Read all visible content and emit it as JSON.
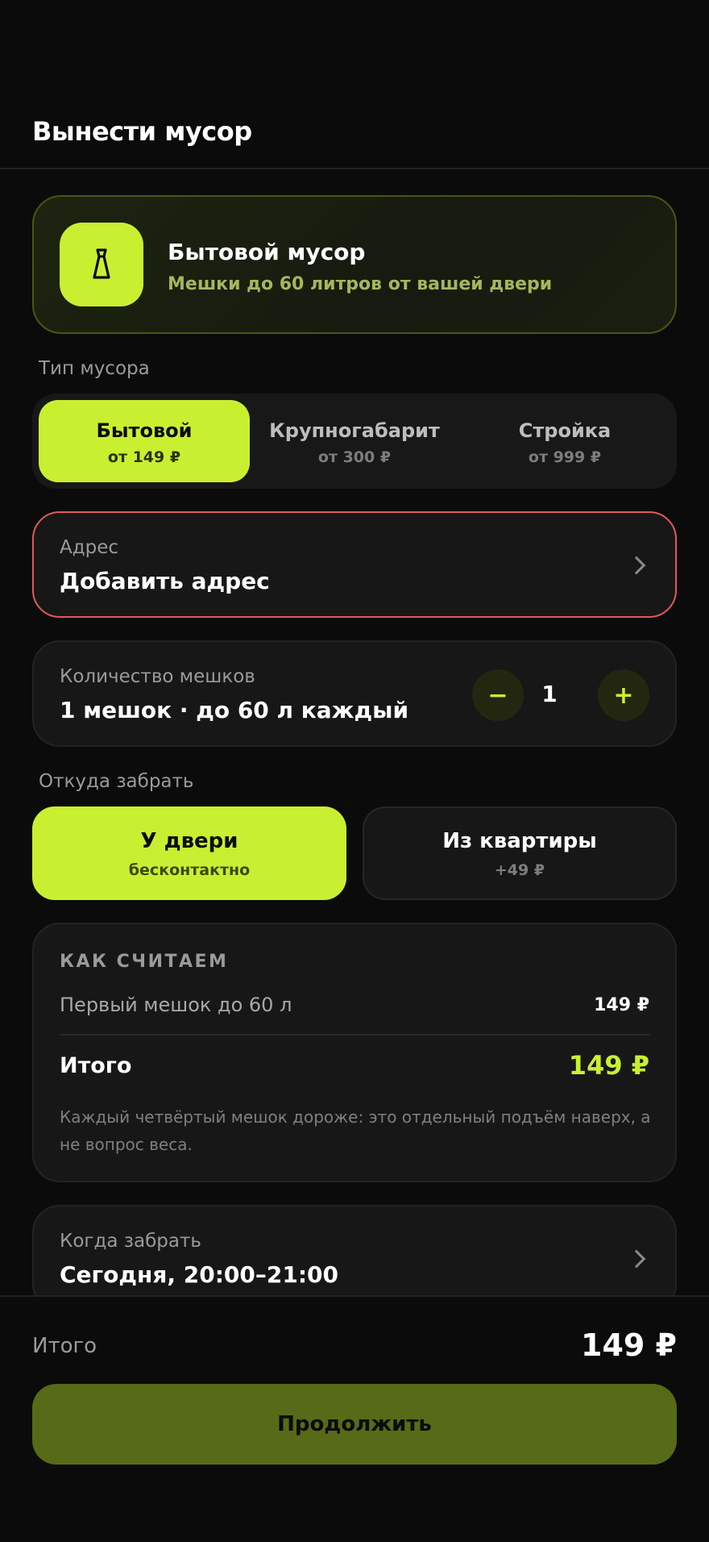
{
  "header": {
    "title": "Вынести мусор"
  },
  "hero": {
    "icon": "trash-bag-icon",
    "title": "Бытовой мусор",
    "subtitle": "Мешки до 60 литров от вашей двери"
  },
  "waste_type": {
    "label": "Тип мусора",
    "options": [
      {
        "title": "Бытовой",
        "price": "от 149 ₽",
        "selected": true
      },
      {
        "title": "Крупногабарит",
        "price": "от 300 ₽",
        "selected": false
      },
      {
        "title": "Стройка",
        "price": "от 999 ₽",
        "selected": false
      }
    ]
  },
  "address": {
    "label": "Адрес",
    "value": "Добавить адрес"
  },
  "bags": {
    "label": "Количество мешков",
    "value": "1 мешок · до 60 л каждый",
    "minus": "−",
    "plus": "+",
    "count": "1"
  },
  "pickup": {
    "label": "Откуда забрать",
    "options": [
      {
        "title": "У двери",
        "sub": "бесконтактно",
        "selected": true
      },
      {
        "title": "Из квартиры",
        "sub": "+49 ₽",
        "selected": false
      }
    ]
  },
  "calc": {
    "heading": "КАК СЧИТАЕМ",
    "row_label": "Первый мешок до 60 л",
    "row_value": "149 ₽",
    "total_label": "Итого",
    "total_value": "149 ₽",
    "note": "Каждый четвёртый мешок дороже: это отдельный подъём наверх, а не вопрос веса."
  },
  "when": {
    "label": "Когда забрать",
    "value": "Сегодня, 20:00–21:00"
  },
  "footer": {
    "total_label": "Итого",
    "total_value": "149 ₽",
    "cta": "Продолжить"
  },
  "colors": {
    "accent": "#c8f031",
    "background": "#0b0b0b",
    "card": "#171717",
    "error_border": "#e05a5a",
    "cta_bg": "#566a17"
  }
}
